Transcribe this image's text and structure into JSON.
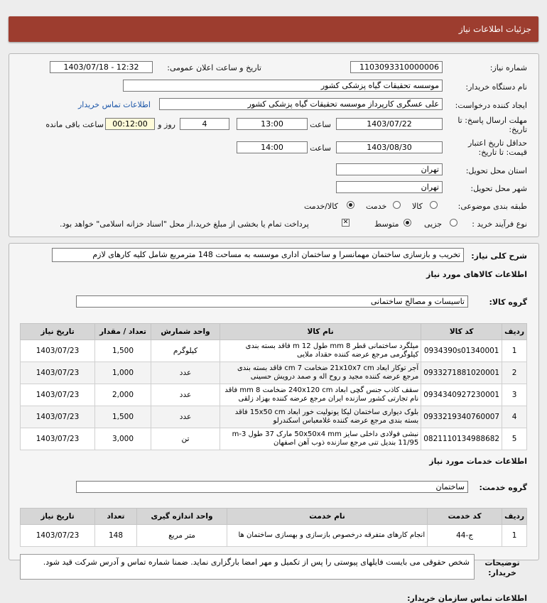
{
  "header": {
    "title": "جزئیات اطلاعات نیاز"
  },
  "form": {
    "need_number_label": "شماره نیاز:",
    "need_number": "1103093310000006",
    "announce_label": "تاریخ و ساعت اعلان عمومی:",
    "announce_value": "1403/07/18 - 12:32",
    "buyer_label": "نام دستگاه خریدار:",
    "buyer_value": "موسسه تحقیقات گیاه پزشکی کشور",
    "creator_label": "ایجاد کننده درخواست:",
    "creator_value": "علی عسگری کارپرداز موسسه تحقیقات گیاه پزشکی کشور",
    "contact_link": "اطلاعات تماس خریدار",
    "deadline_label": "مهلت ارسال پاسخ: تا تاریخ:",
    "deadline_date": "1403/07/22",
    "time_label": "ساعت",
    "deadline_time": "13:00",
    "days_value": "4",
    "days_label": "روز و",
    "remaining_time": "00:12:00",
    "remaining_label": "ساعت باقی مانده",
    "validity_label": "حداقل تاریخ اعتبار قیمت: تا تاریخ:",
    "validity_date": "1403/08/30",
    "validity_time": "14:00",
    "province_label": "استان محل تحویل:",
    "province_value": "تهران",
    "city_label": "شهر محل تحویل:",
    "city_value": "تهران",
    "category_label": "طبقه بندی موضوعی:",
    "category_options": [
      "کالا",
      "خدمت",
      "کالا/خدمت"
    ],
    "category_selected": 2,
    "process_label": "نوع فرآیند خرید :",
    "process_options": [
      "جزیی",
      "متوسط"
    ],
    "process_selected": 1,
    "payment_note": "پرداخت تمام یا بخشی از مبلغ خرید،از محل \"اسناد خزانه اسلامی\" خواهد بود.",
    "payment_checked": true
  },
  "description": {
    "label": "شرح کلی نیاز:",
    "value": "تخریب و بازسازی ساختمان مهمانسرا و ساختمان اداری موسسه به مساحت 148 مترمربع شامل کلیه کارهای لازم"
  },
  "goods": {
    "section_title": "اطلاعات کالاهای مورد نیاز",
    "group_label": "گروه کالا:",
    "group_value": "تاسیسات و مصالح ساختمانی",
    "columns": [
      "ردیف",
      "کد کالا",
      "نام کالا",
      "واحد شمارش",
      "تعداد / مقدار",
      "تاریخ نیاز"
    ],
    "rows": [
      [
        "1",
        "0934390s01340001",
        "میلگرد ساختمانی قطر mm 8 طول m 12 فاقد بسته بندی کیلوگرمی مرجع عرضه کننده حقداد ملایی",
        "کیلوگرم",
        "1,500",
        "1403/07/23"
      ],
      [
        "2",
        "0933271881020001",
        "آجر توکار ابعاد 21x10x7 cm ضخامت cm 7 فاقد بسته بندی مرجع عرضه کننده مجید و روح اله و صمد درویش حسینی",
        "عدد",
        "1,000",
        "1403/07/23"
      ],
      [
        "3",
        "0934340927230001",
        "سقف کاذب جنس گچی ابعاد 240x120 cm ضخامت mm 8 فاقد نام تجارتی کشور سازنده ایران مرجع عرضه کننده بهزاد زلقی",
        "عدد",
        "2,000",
        "1403/07/23"
      ],
      [
        "4",
        "0933219340760007",
        "بلوک دیواری ساختمان لیکا یونولیت خور ابعاد 15x50 cm فاقد بسته بندی مرجع عرضه کننده غلامعباس اسکندرلو",
        "عدد",
        "1,500",
        "1403/07/23"
      ],
      [
        "5",
        "0821110134988682",
        "نبشی فولادی داخلی سایز 50x50x4 mm مارک 37 طول 3-m 11/95 بندیل تنی مرجع سازنده ذوب آهن اصفهان",
        "تن",
        "3,000",
        "1403/07/23"
      ]
    ]
  },
  "services": {
    "section_title": "اطلاعات خدمات مورد نیاز",
    "group_label": "گروه خدمت:",
    "group_value": "ساختمان",
    "columns": [
      "ردیف",
      "کد خدمت",
      "نام خدمت",
      "واحد اندازه گیری",
      "تعداد",
      "تاریخ نیاز"
    ],
    "rows": [
      [
        "1",
        "ج-44",
        "انجام کارهای متفرقه درخصوص بازسازی و بهسازی ساختمان ها",
        "متر مربع",
        "148",
        "1403/07/23"
      ]
    ]
  },
  "buyer_notes": {
    "label": "توضیحات خریدار:",
    "value": "شخص حقوقی می بایست فایلهای پیوستی را پس از تکمیل و مهر امضا بارگزاری نماید. ضمنا شماره تماس و آدرس شرکت قید شود."
  },
  "footer_partial": "اطلاعات تماس سازمان خریدار:"
}
